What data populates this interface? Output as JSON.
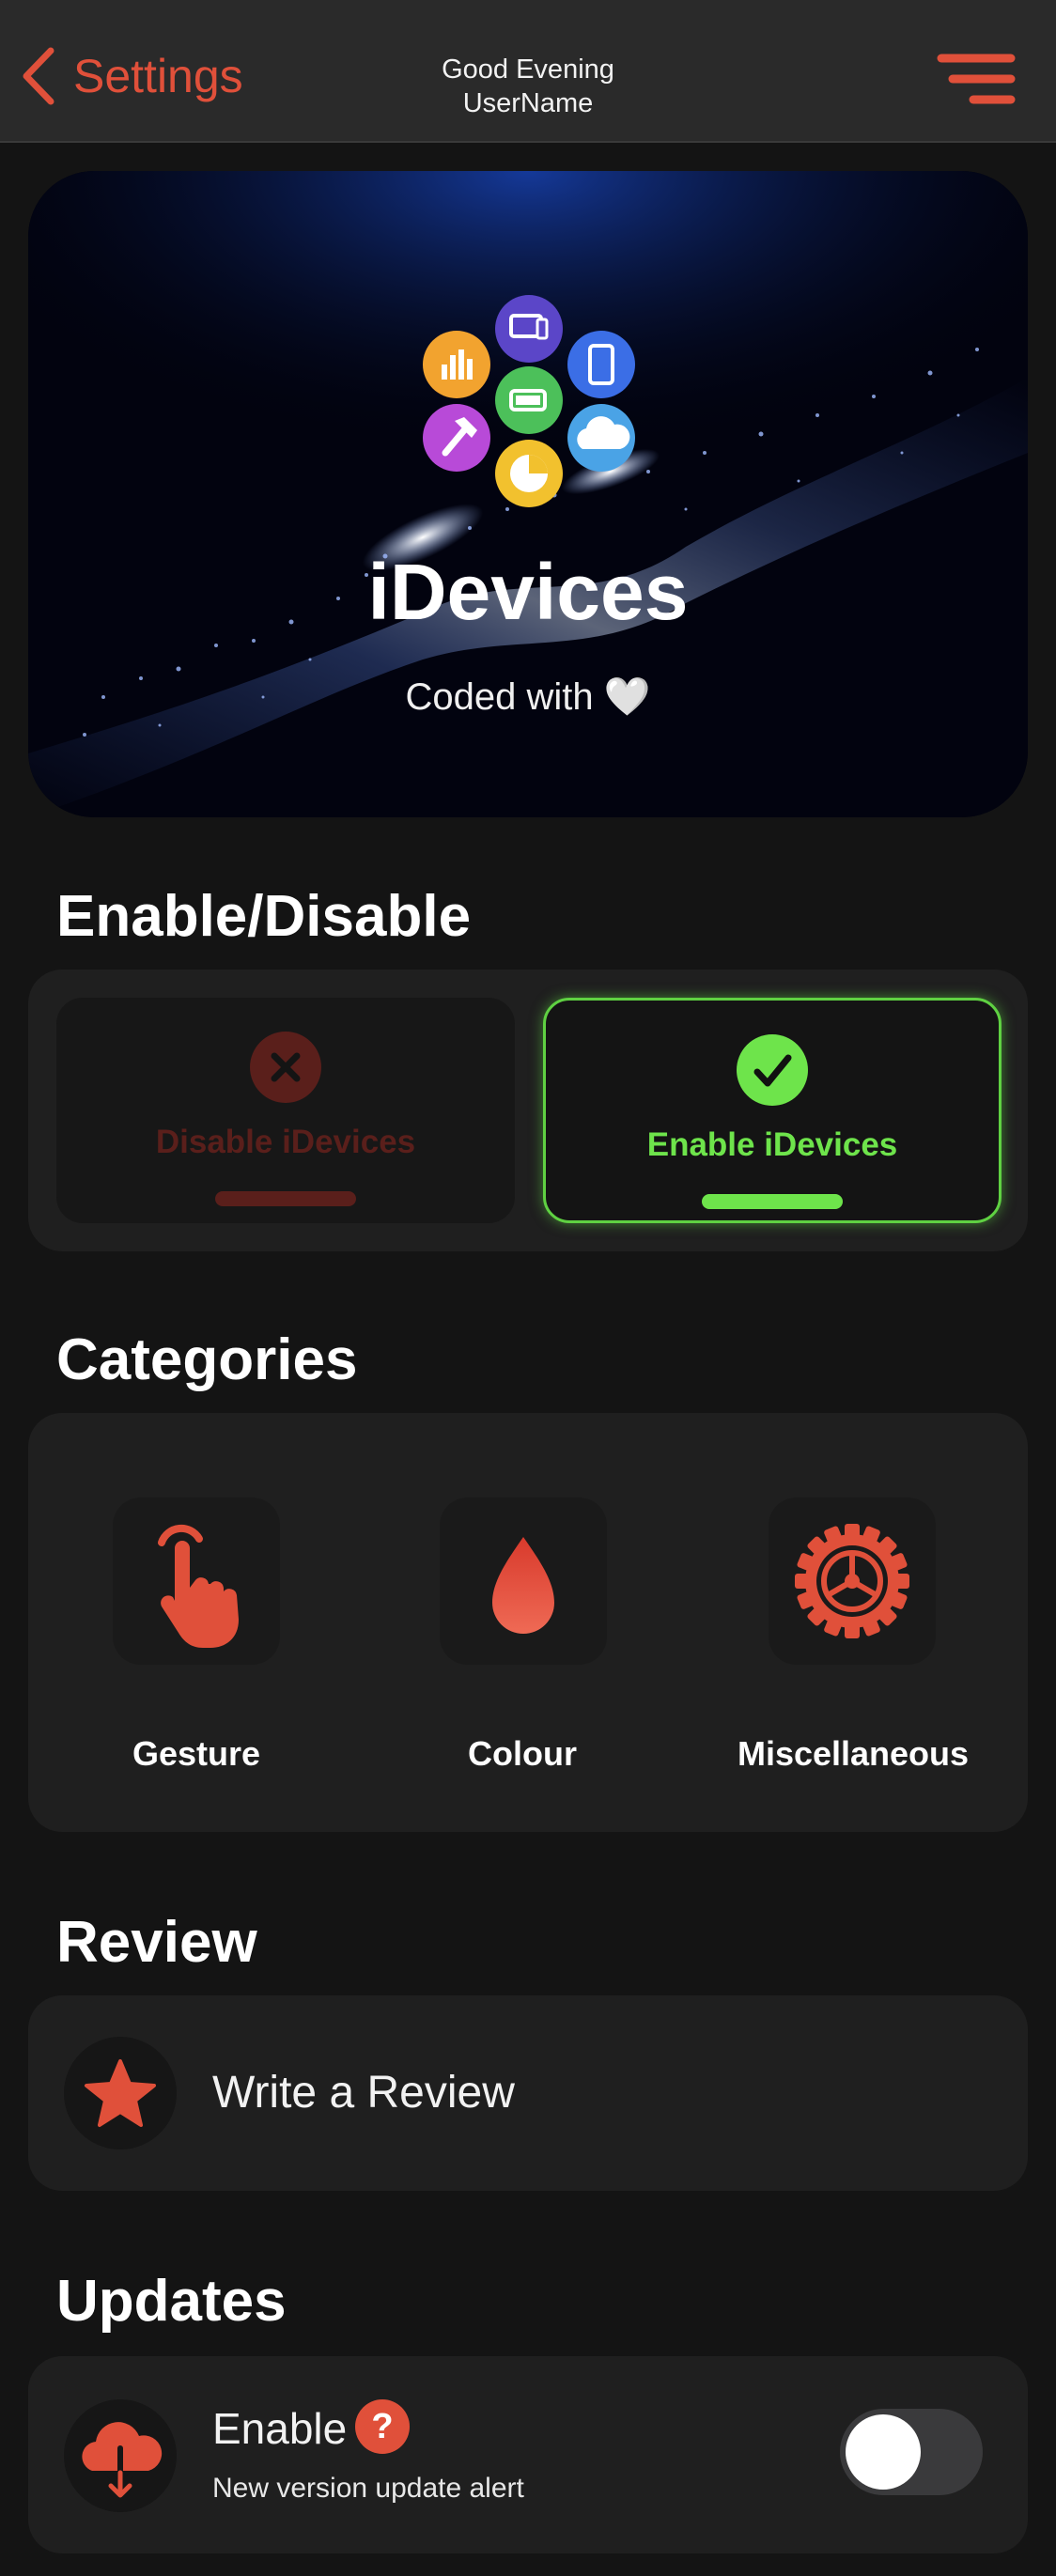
{
  "nav": {
    "back_label": "Settings",
    "greeting": "Good Evening",
    "username": "UserName"
  },
  "hero": {
    "title": "iDevices",
    "subtitle": "Coded with 🤍"
  },
  "enable_section": {
    "title": "Enable/Disable",
    "disable_label": "Disable iDevices",
    "enable_label": "Enable iDevices",
    "selected": "enable"
  },
  "categories": {
    "title": "Categories",
    "items": [
      {
        "label": "Gesture",
        "icon": "hand-tap-icon"
      },
      {
        "label": "Colour",
        "icon": "drop-icon"
      },
      {
        "label": "Miscellaneous",
        "icon": "gear-icon"
      }
    ]
  },
  "review": {
    "title": "Review",
    "label": "Write a Review",
    "icon": "star-icon"
  },
  "updates": {
    "title": "Updates",
    "label": "Enable",
    "help": "?",
    "subtitle": "New version update alert",
    "toggle_on": false,
    "icon": "cloud-download-icon"
  },
  "colors": {
    "accent": "#e0503a",
    "enable_green": "#6ee44b",
    "background": "#141414",
    "card": "#1f1f1f"
  }
}
